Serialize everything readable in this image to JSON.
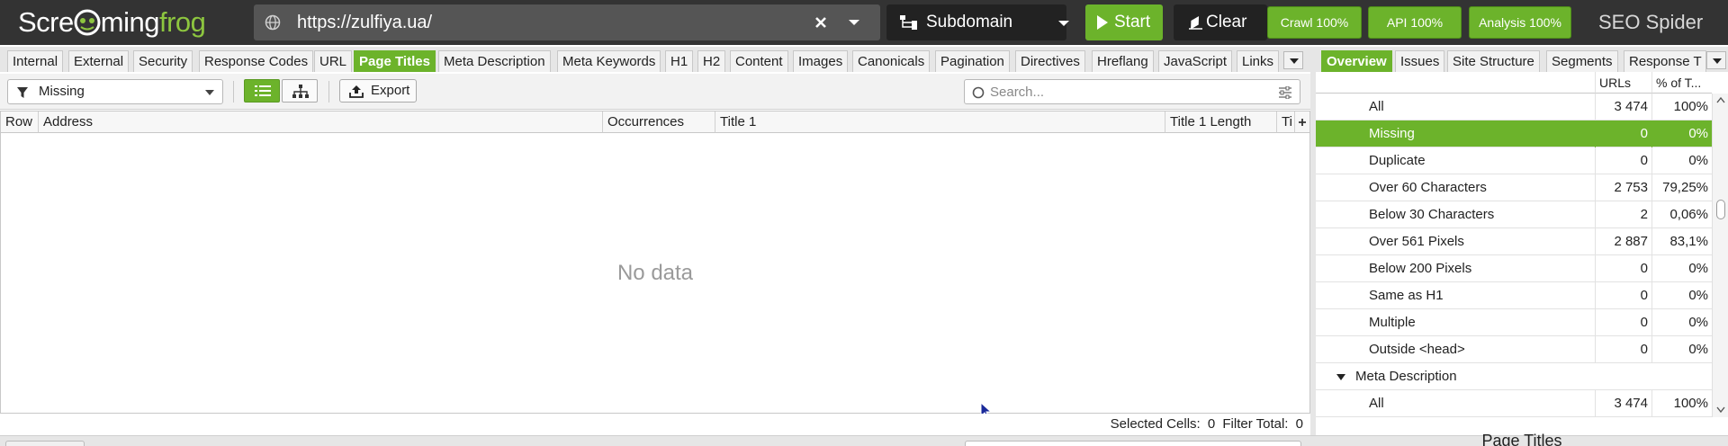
{
  "topbar": {
    "logo_part1": "Scre",
    "logo_part2": "ming",
    "logo_part3": "frog",
    "url": "https://zulfiya.ua/",
    "mode": "Subdomain",
    "start_label": "Start",
    "clear_label": "Clear",
    "crawl_label": "Crawl 100%",
    "api_label": "API 100%",
    "analysis_label": "Analysis 100%",
    "brand": "SEO Spider"
  },
  "tabs": [
    "Internal",
    "External",
    "Security",
    "Response Codes",
    "URL",
    "Page Titles",
    "Meta Description",
    "Meta Keywords",
    "H1",
    "H2",
    "Content",
    "Images",
    "Canonicals",
    "Pagination",
    "Directives",
    "Hreflang",
    "JavaScript",
    "Links"
  ],
  "active_tab": "Page Titles",
  "right_tabs": [
    "Overview",
    "Issues",
    "Site Structure",
    "Segments",
    "Response T"
  ],
  "active_right_tab": "Overview",
  "toolbar": {
    "filter_value": "Missing",
    "export_label": "Export",
    "search_placeholder": "Search..."
  },
  "grid": {
    "columns": [
      "Row",
      "Address",
      "Occurrences",
      "Title 1",
      "Title 1 Length",
      "Ti"
    ],
    "empty_text": "No data"
  },
  "status": {
    "selected_label": "Selected Cells:",
    "selected_value": "0",
    "filter_label": "Filter Total:",
    "filter_value": "0"
  },
  "overview": {
    "header_urls": "URLs",
    "header_pct": "% of T...",
    "rows": [
      {
        "name": "All",
        "urls": "3 474",
        "pct": "100%"
      },
      {
        "name": "Missing",
        "urls": "0",
        "pct": "0%"
      },
      {
        "name": "Duplicate",
        "urls": "0",
        "pct": "0%"
      },
      {
        "name": "Over 60 Characters",
        "urls": "2 753",
        "pct": "79,25%"
      },
      {
        "name": "Below 30 Characters",
        "urls": "2",
        "pct": "0,06%"
      },
      {
        "name": "Over 561 Pixels",
        "urls": "2 887",
        "pct": "83,1%"
      },
      {
        "name": "Below 200 Pixels",
        "urls": "0",
        "pct": "0%"
      },
      {
        "name": "Same as H1",
        "urls": "0",
        "pct": "0%"
      },
      {
        "name": "Multiple",
        "urls": "0",
        "pct": "0%"
      },
      {
        "name": "Outside <head>",
        "urls": "0",
        "pct": "0%"
      },
      {
        "name": "Meta Description",
        "urls": "",
        "pct": ""
      },
      {
        "name": "All",
        "urls": "3 474",
        "pct": "100%"
      }
    ],
    "selected_row": "Missing",
    "panel_title": "Page Titles"
  },
  "colors": {
    "accent": "#6cb32b",
    "topbar": "#333333",
    "logo_green": "#8dc63f"
  }
}
